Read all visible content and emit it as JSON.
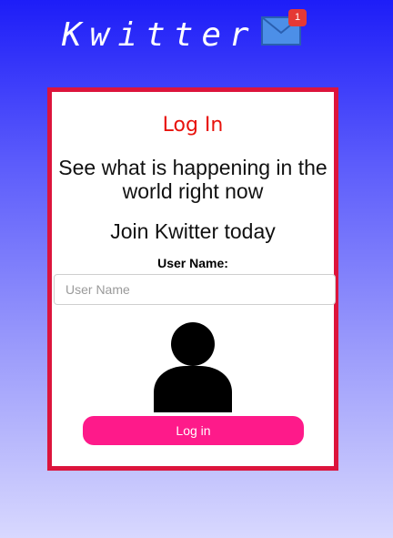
{
  "header": {
    "brand": "Kwitter",
    "notification_count": "1",
    "mail_icon": "envelope-icon"
  },
  "login": {
    "title": "Log In",
    "tagline": "See what is happening in the world right now",
    "join_text": "Join Kwitter today",
    "username_label": "User Name:",
    "username_placeholder": "User Name",
    "username_value": "",
    "avatar_icon": "user-silhouette-icon",
    "submit_label": "Log in"
  },
  "colors": {
    "card_border": "#dc143c",
    "title": "#e8120c",
    "button": "#fe1a8a",
    "badge": "#e53935"
  }
}
